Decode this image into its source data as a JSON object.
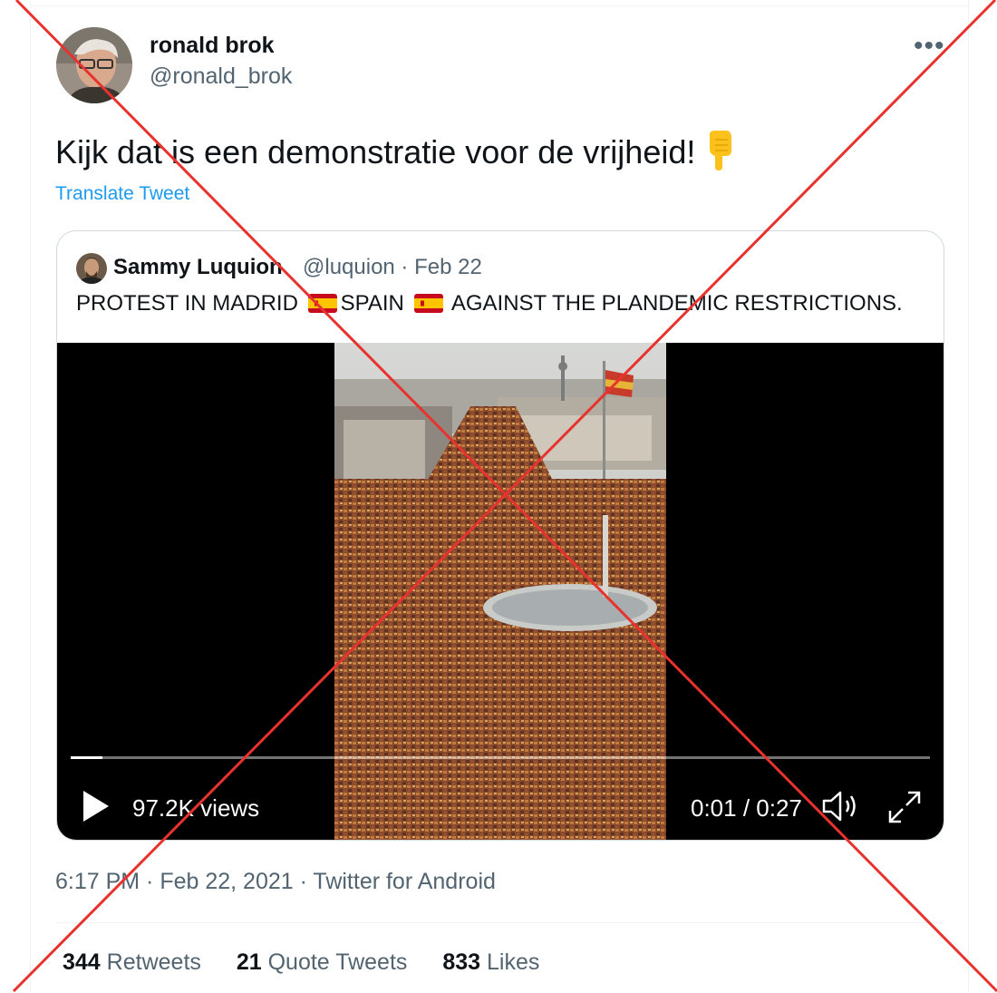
{
  "author": {
    "name": "ronald brok",
    "handle": "@ronald_brok"
  },
  "tweet": {
    "text": "Kijk dat is een demonstratie voor de vrijheid!",
    "emoji": "backhand-index-pointing-down-emoji",
    "translate_label": "Translate Tweet"
  },
  "quoted": {
    "name": "Sammy Luquion",
    "meta": "@luquion · Feb 22",
    "text_parts": [
      "PROTEST IN MADRID",
      "SPAIN",
      "AGAINST THE PLANDEMIC RESTRICTIONS."
    ],
    "flag": "spain-flag-emoji"
  },
  "video": {
    "views": "97.2K views",
    "time": "0:01 / 0:27",
    "progress": 0.037
  },
  "footer": {
    "timestamp": "6:17 PM · Feb 22, 2021 · Twitter for Android",
    "retweets_count": "344",
    "retweets_label": "Retweets",
    "quotes_count": "21",
    "quotes_label": "Quote Tweets",
    "likes_count": "833",
    "likes_label": "Likes"
  },
  "overlay": {
    "mark": "red-x-cross",
    "color": "#e8322e"
  }
}
